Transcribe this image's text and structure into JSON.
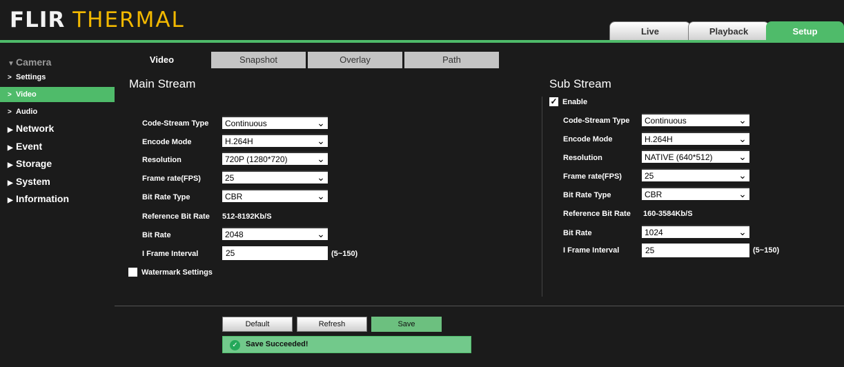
{
  "header": {
    "brand": "FLIR",
    "product": "THERMAL",
    "tabs": [
      "Live",
      "Playback",
      "Setup"
    ],
    "active_tab": "Setup"
  },
  "sidebar": {
    "camera": "Camera",
    "camera_items": [
      "Settings",
      "Video",
      "Audio"
    ],
    "active_item": "Video",
    "categories": [
      "Network",
      "Event",
      "Storage",
      "System",
      "Information"
    ]
  },
  "content_tabs": [
    "Video",
    "Snapshot",
    "Overlay",
    "Path"
  ],
  "main_stream": {
    "title": "Main Stream",
    "labels": {
      "code_stream_type": "Code-Stream Type",
      "encode_mode": "Encode Mode",
      "resolution": "Resolution",
      "frame_rate": "Frame rate(FPS)",
      "bit_rate_type": "Bit Rate Type",
      "reference_bit_rate": "Reference Bit Rate",
      "bit_rate": "Bit Rate",
      "i_frame_interval": "I Frame Interval"
    },
    "values": {
      "code_stream_type": "Continuous",
      "encode_mode": "H.264H",
      "resolution": "720P (1280*720)",
      "frame_rate": "25",
      "bit_rate_type": "CBR",
      "reference_bit_rate": "512-8192Kb/S",
      "bit_rate": "2048",
      "i_frame_interval": "25"
    },
    "i_frame_range": "(5~150)",
    "watermark_label": "Watermark Settings",
    "watermark_checked": false
  },
  "sub_stream": {
    "title": "Sub Stream",
    "enable_label": "Enable",
    "enable_checked": true,
    "labels": {
      "code_stream_type": "Code-Stream Type",
      "encode_mode": "Encode Mode",
      "resolution": "Resolution",
      "frame_rate": "Frame rate(FPS)",
      "bit_rate_type": "Bit Rate Type",
      "reference_bit_rate": "Reference Bit Rate",
      "bit_rate": "Bit Rate",
      "i_frame_interval": "I Frame Interval"
    },
    "values": {
      "code_stream_type": "Continuous",
      "encode_mode": "H.264H",
      "resolution": "NATIVE (640*512)",
      "frame_rate": "25",
      "bit_rate_type": "CBR",
      "reference_bit_rate": "160-3584Kb/S",
      "bit_rate": "1024",
      "i_frame_interval": "25"
    },
    "i_frame_range": "(5~150)"
  },
  "footer": {
    "default_label": "Default",
    "refresh_label": "Refresh",
    "save_label": "Save",
    "status_text": "Save Succeeded!"
  },
  "colors": {
    "accent": "#4fbb6a",
    "background": "#1b1b1b",
    "brand_yellow": "#f2b800",
    "status_bg": "#72c98b"
  }
}
